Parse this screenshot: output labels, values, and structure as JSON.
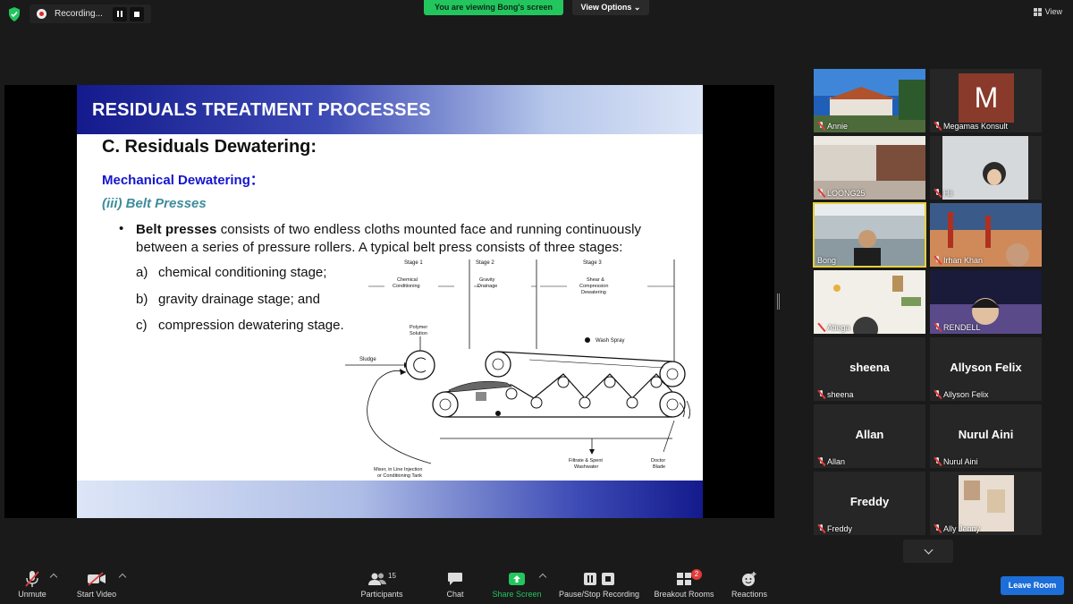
{
  "top": {
    "recording_label": "Recording...",
    "viewing_banner": "You are viewing Bong's screen",
    "view_options": "View Options",
    "view_button": "View"
  },
  "slide": {
    "header": "RESIDUALS TREATMENT PROCESSES",
    "title": "C. Residuals Dewatering:",
    "subtitle": "Mechanical Dewatering：",
    "subsection": "(iii) Belt Presses",
    "bullet_bold": "Belt presses",
    "bullet_text": " consists of two endless cloths mounted face and running continuously between a series of pressure rollers. A typical belt press consists of three stages:",
    "items": [
      {
        "letter": "a)",
        "text": "chemical conditioning stage;"
      },
      {
        "letter": "b)",
        "text": "gravity drainage stage; and"
      },
      {
        "letter": "c)",
        "text": "compression dewatering stage."
      }
    ],
    "footer_text": "",
    "diagram": {
      "stage1": "Stage 1",
      "stage2": "Stage 2",
      "stage3": "Stage 3",
      "stage1_desc_1": "Chemical",
      "stage1_desc_2": "Conditioning",
      "stage2_desc_1": "Gravity",
      "stage2_desc_2": "Drainage",
      "stage3_desc_1": "Shear &",
      "stage3_desc_2": "Compression",
      "stage3_desc_3": "Dewatering",
      "polymer_1": "Polymer",
      "polymer_2": "Solution",
      "sludge": "Sludge",
      "wash_spray": "Wash Spray",
      "filtrate_1": "Filtrate & Spent",
      "filtrate_2": "Washwater",
      "doctor_1": "Doctor",
      "doctor_2": "Blade",
      "mixer_1": "Mixer, in Line Injection",
      "mixer_2": "or Conditioning Tank"
    }
  },
  "participants": [
    {
      "name": "Annie",
      "type": "video"
    },
    {
      "name": "Megamas Konsult",
      "type": "avatar",
      "initial": "M"
    },
    {
      "name": "LOONG25",
      "type": "video"
    },
    {
      "name": "Hii",
      "type": "video"
    },
    {
      "name": "Bong",
      "type": "video",
      "active": true
    },
    {
      "name": "Irhan Khan",
      "type": "video"
    },
    {
      "name": "Atiega",
      "type": "video"
    },
    {
      "name": "RENDELL",
      "type": "video"
    },
    {
      "name": "sheena",
      "type": "name"
    },
    {
      "name": "Allyson Felix",
      "type": "name"
    },
    {
      "name": "Allan",
      "type": "name"
    },
    {
      "name": "Nurul Aini",
      "type": "name"
    },
    {
      "name": "Freddy",
      "type": "name"
    },
    {
      "name": "Ally Jenny",
      "type": "video"
    }
  ],
  "toolbar": {
    "unmute": "Unmute",
    "start_video": "Start Video",
    "participants": "Participants",
    "participants_count": "15",
    "chat": "Chat",
    "share_screen": "Share Screen",
    "pause_stop": "Pause/Stop Recording",
    "breakout": "Breakout Rooms",
    "breakout_badge": "2",
    "reactions": "Reactions",
    "leave": "Leave Room"
  },
  "colors": {
    "accent_green": "#23c55e",
    "leave_blue": "#1d6ed8",
    "active_speaker": "#e6d23c",
    "mute_red": "#e23a3a"
  }
}
